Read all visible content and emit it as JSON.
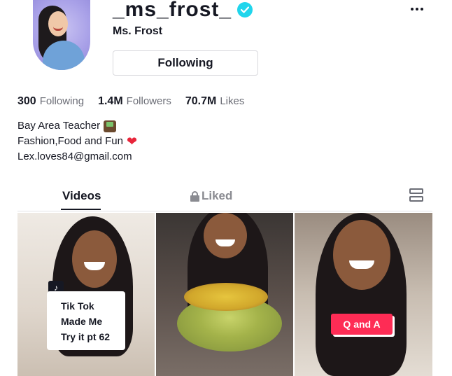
{
  "profile": {
    "username": "_ms_frost_",
    "display_name": "Ms. Frost",
    "follow_button_label": "Following",
    "verified": true
  },
  "stats": {
    "following_count": "300",
    "following_label": "Following",
    "followers_count": "1.4M",
    "followers_label": "Followers",
    "likes_count": "70.7M",
    "likes_label": "Likes"
  },
  "bio": {
    "line1": "Bay Area Teacher",
    "line2": "Fashion,Food and Fun",
    "line3": "Lex.loves84@gmail.com"
  },
  "tabs": {
    "videos_label": "Videos",
    "liked_label": "Liked"
  },
  "videos": [
    {
      "caption_line1": "Tik Tok",
      "caption_line2": "Made Me",
      "caption_line3": "Try it pt 62"
    },
    {
      "caption": ""
    },
    {
      "badge": "Q and A"
    }
  ],
  "icons": {
    "more": "more-icon",
    "verified": "verified-badge-icon",
    "lock": "lock-icon",
    "layout": "layout-toggle-icon",
    "heart": "heart-emoji-icon",
    "teacher": "teacher-emoji-icon"
  },
  "colors": {
    "accent": "#fe2c55",
    "verified": "#20d5ec",
    "text_primary": "#161823",
    "text_secondary": "#6b6d76"
  }
}
